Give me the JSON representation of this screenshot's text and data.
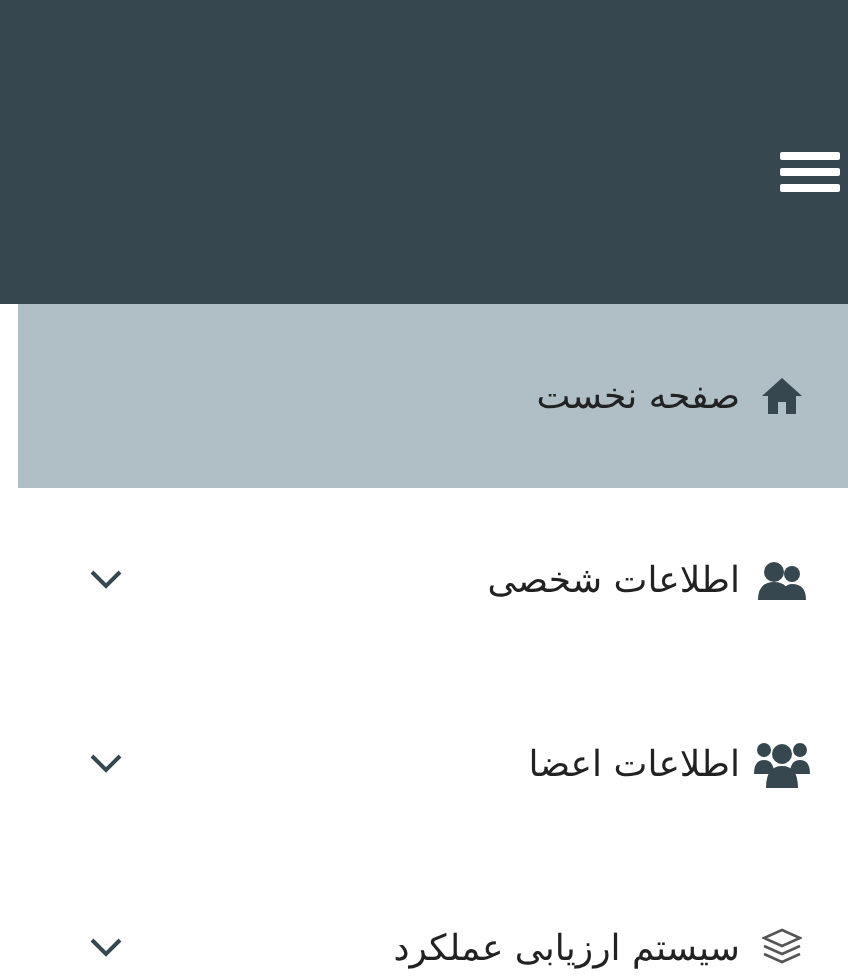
{
  "menu": [
    {
      "label": "صفحه نخست",
      "selected": true,
      "expandable": false
    },
    {
      "label": "اطلاعات شخصی",
      "selected": false,
      "expandable": true
    },
    {
      "label": "اطلاعات اعضا",
      "selected": false,
      "expandable": true
    },
    {
      "label": "سیستم ارزیابی عملکرد",
      "selected": false,
      "expandable": true
    }
  ]
}
